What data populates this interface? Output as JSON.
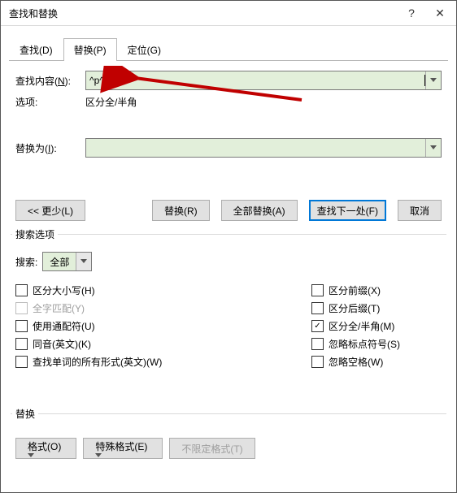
{
  "title": "查找和替换",
  "help_symbol": "?",
  "close_symbol": "✕",
  "tabs": {
    "find": "查找(D)",
    "replace": "替换(P)",
    "goto": "定位(G)"
  },
  "find_label_pre": "查找内容(",
  "find_label_u": "N",
  "find_label_post": "):",
  "find_value": "^p^p",
  "options_label": "选项:",
  "options_value": "区分全/半角",
  "replace_label_pre": "替换为(",
  "replace_label_u": "I",
  "replace_label_post": "):",
  "buttons": {
    "less": "<< 更少(L)",
    "replace": "替换(R)",
    "replace_all": "全部替换(A)",
    "find_next": "查找下一处(F)",
    "cancel": "取消"
  },
  "search_options_title": "搜索选项",
  "search_label": "搜索:",
  "search_value": "全部",
  "checks_left": [
    {
      "label": "区分大小写(H)",
      "checked": false,
      "disabled": false
    },
    {
      "label": "全字匹配(Y)",
      "checked": false,
      "disabled": true
    },
    {
      "label": "使用通配符(U)",
      "checked": false,
      "disabled": false
    },
    {
      "label": "同音(英文)(K)",
      "checked": false,
      "disabled": false
    },
    {
      "label": "查找单词的所有形式(英文)(W)",
      "checked": false,
      "disabled": false
    }
  ],
  "checks_right": [
    {
      "label": "区分前缀(X)",
      "checked": false,
      "disabled": false
    },
    {
      "label": "区分后缀(T)",
      "checked": false,
      "disabled": false
    },
    {
      "label": "区分全/半角(M)",
      "checked": true,
      "disabled": false
    },
    {
      "label": "忽略标点符号(S)",
      "checked": false,
      "disabled": false
    },
    {
      "label": "忽略空格(W)",
      "checked": false,
      "disabled": false
    }
  ],
  "replace_section_title": "替换",
  "format_btn": "格式(O)",
  "special_btn": "特殊格式(E)",
  "noformat_btn": "不限定格式(T)",
  "caret": "▾",
  "check_mark": "✓",
  "arrow_color": "#c00000"
}
